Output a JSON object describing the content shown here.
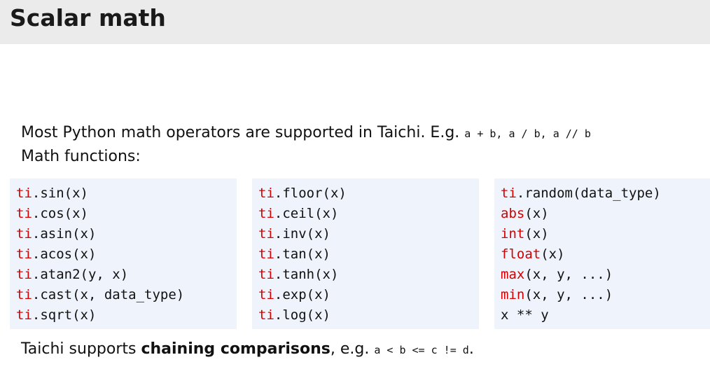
{
  "slide": {
    "title": "Scalar math"
  },
  "intro": {
    "text": "Most Python math operators are supported in Taichi. E.g. ",
    "code_example": "a + b, a / b, a // b",
    "functions_label": "Math functions:"
  },
  "columns": [
    {
      "lines": [
        {
          "prefix": "ti",
          "rest": ".sin(x)"
        },
        {
          "prefix": "ti",
          "rest": ".cos(x)"
        },
        {
          "prefix": "ti",
          "rest": ".asin(x)"
        },
        {
          "prefix": "ti",
          "rest": ".acos(x)"
        },
        {
          "prefix": "ti",
          "rest": ".atan2(y, x)"
        },
        {
          "prefix": "ti",
          "rest": ".cast(x, data_type)"
        },
        {
          "prefix": "ti",
          "rest": ".sqrt(x)"
        }
      ]
    },
    {
      "lines": [
        {
          "prefix": "ti",
          "rest": ".floor(x)"
        },
        {
          "prefix": "ti",
          "rest": ".ceil(x)"
        },
        {
          "prefix": "ti",
          "rest": ".inv(x)"
        },
        {
          "prefix": "ti",
          "rest": ".tan(x)"
        },
        {
          "prefix": "ti",
          "rest": ".tanh(x)"
        },
        {
          "prefix": "ti",
          "rest": ".exp(x)"
        },
        {
          "prefix": "ti",
          "rest": ".log(x)"
        }
      ]
    },
    {
      "lines": [
        {
          "prefix": "ti",
          "rest": ".random(data_type)"
        },
        {
          "prefix": "abs",
          "rest": "(x)"
        },
        {
          "prefix": "int",
          "rest": "(x)"
        },
        {
          "prefix": "float",
          "rest": "(x)"
        },
        {
          "prefix": "max",
          "rest": "(x, y, ...)"
        },
        {
          "prefix": "min",
          "rest": "(x, y, ...)"
        },
        {
          "prefix": "",
          "rest": "x ** y"
        }
      ]
    }
  ],
  "footer": {
    "text_before": "Taichi supports ",
    "bold_text": "chaining comparisons",
    "text_after": ", e.g. ",
    "code_example": "a < b <= c != d",
    "end": "."
  },
  "colors": {
    "keyword": "#d40000",
    "code_background": "#eef3fc",
    "title_bar": "#ebebeb"
  }
}
